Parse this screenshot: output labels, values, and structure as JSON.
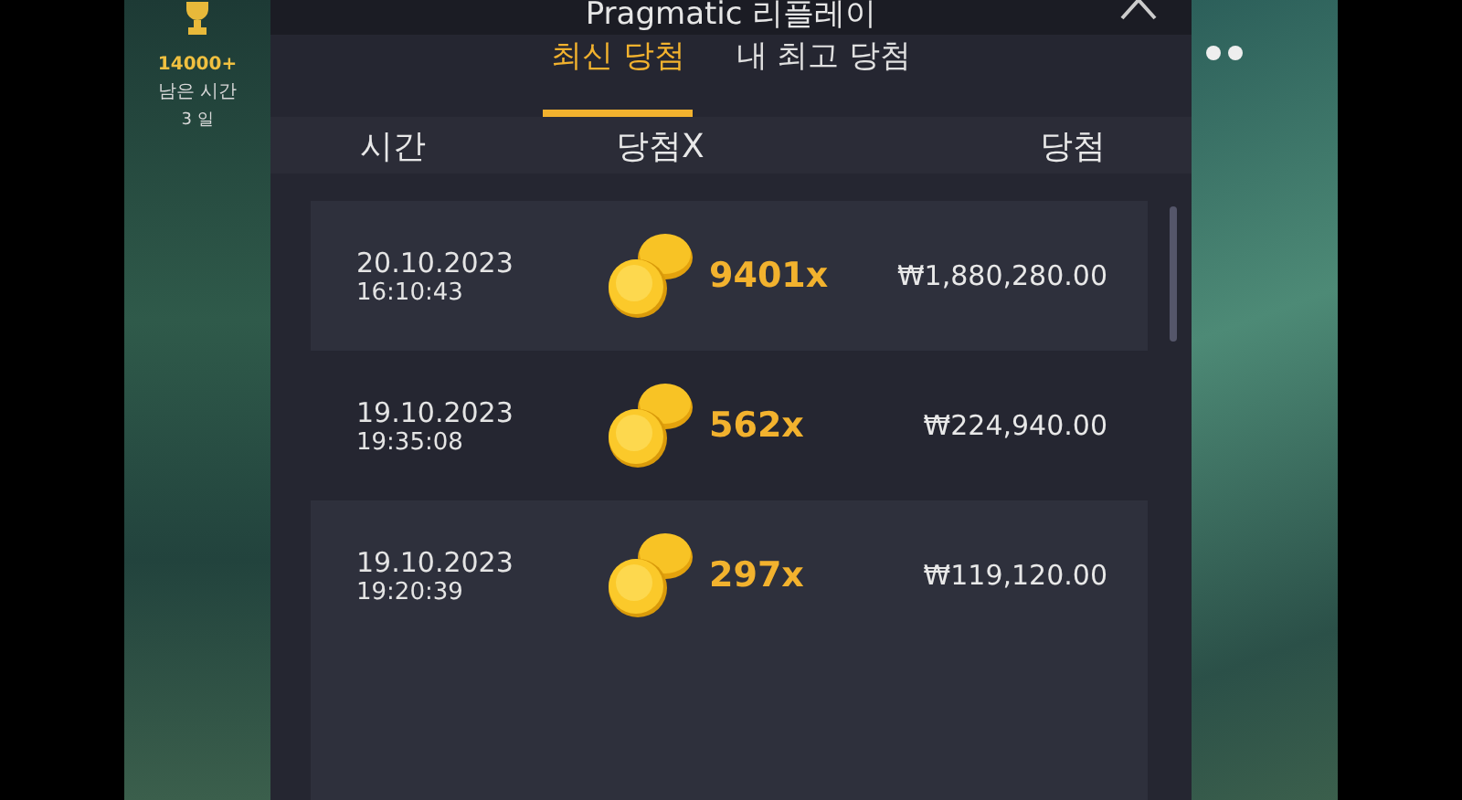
{
  "game_panel": {
    "prize": "14000+",
    "remaining_label": "남은 시간",
    "remaining_value": "3 일"
  },
  "modal": {
    "title": "Pragmatic 리플레이",
    "tabs": [
      {
        "label": "최신 당첨",
        "selected": true
      },
      {
        "label": "내 최고 당첨",
        "selected": false
      }
    ],
    "columns": [
      "시간",
      "당첨X",
      "당첨"
    ],
    "rows": [
      {
        "date": "20.10.2023",
        "time": "16:10:43",
        "multiplier": "9401x",
        "win": "₩1,880,280.00"
      },
      {
        "date": "19.10.2023",
        "time": "19:35:08",
        "multiplier": "562x",
        "win": "₩224,940.00"
      },
      {
        "date": "19.10.2023",
        "time": "19:20:39",
        "multiplier": "297x",
        "win": "₩119,120.00"
      }
    ]
  }
}
